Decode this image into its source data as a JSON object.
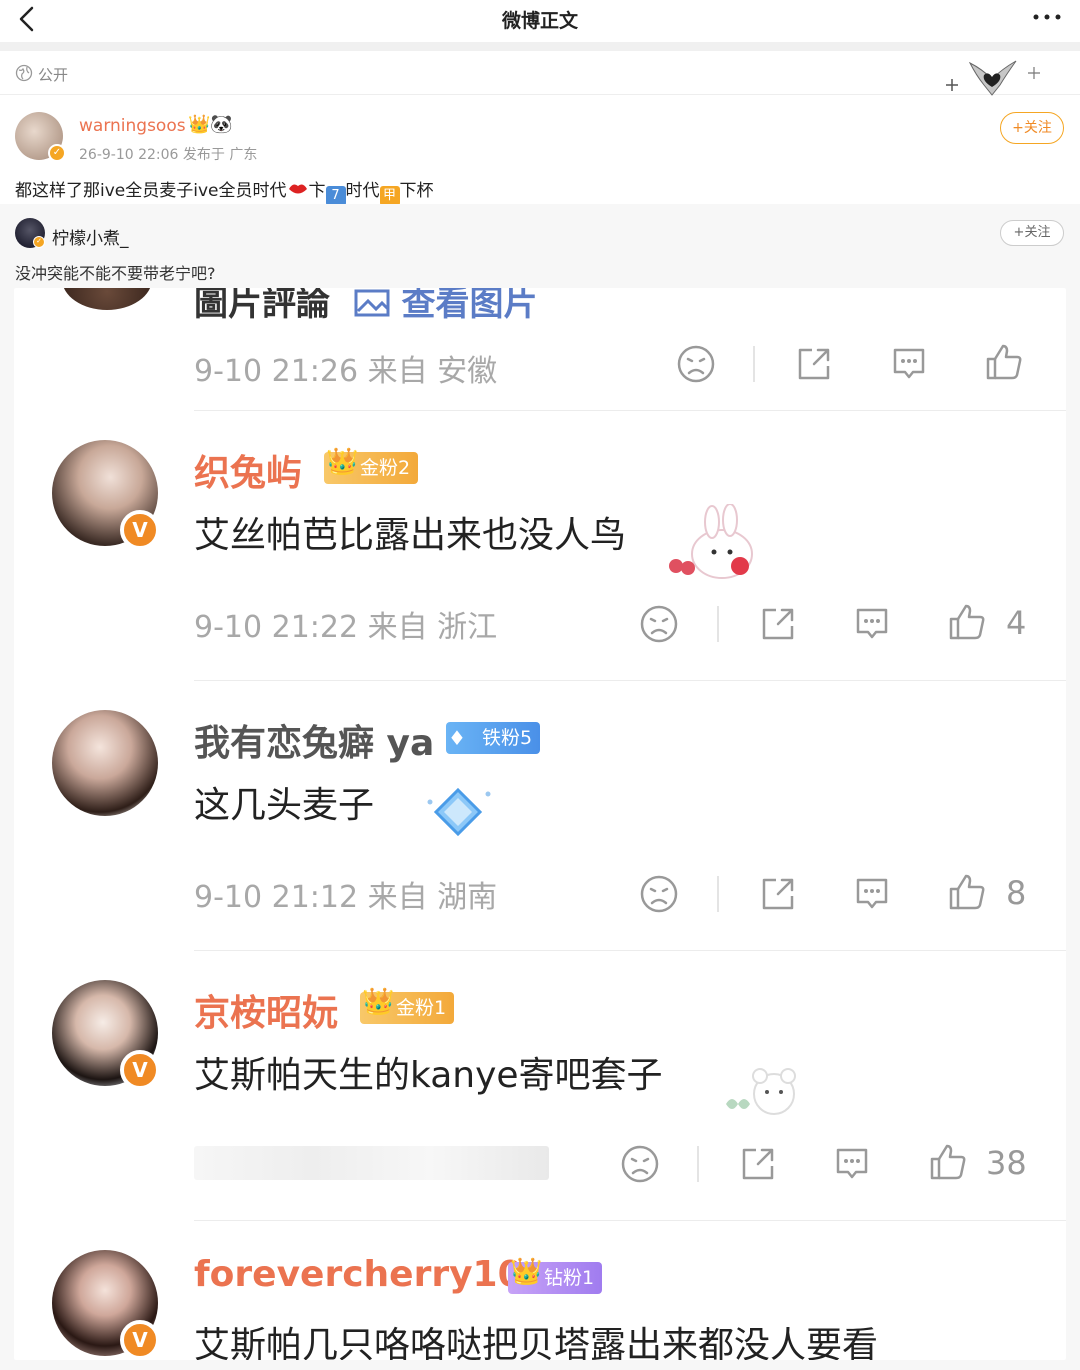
{
  "header": {
    "title": "微博正文"
  },
  "visibility": {
    "label": "公开"
  },
  "post": {
    "author": "warningsoos",
    "author_emoji": "👑🐼",
    "meta": "26-9-10 22:06  发布于 广东",
    "follow_label": "+关注",
    "text_a": "都这样了那ive全员麦子ive全员时代",
    "text_b": "卞",
    "emoji_7": "7",
    "text_c": "时代",
    "emoji_jia": "甲",
    "text_d": "下杯"
  },
  "comment": {
    "author": "柠檬小煮_",
    "follow_label": "+关注",
    "text": "没冲突能不能不要带老宁吧?"
  },
  "screenshot": {
    "cut_off": {
      "title": "圖片評論",
      "link": "查看图片",
      "meta": "9-10 21:26 来自 安徽"
    },
    "comments": [
      {
        "name": "织兔屿",
        "badge": "金粉2",
        "body": "艾丝帕芭比露出来也没人鸟",
        "meta": "9-10 21:22 来自 浙江",
        "likes": "4"
      },
      {
        "name": "我有恋兔癖 ya",
        "badge": "铁粉5",
        "body": "这几头麦子",
        "meta": "9-10 21:12 来自 湖南",
        "likes": "8"
      },
      {
        "name": "京桉昭妧",
        "badge": "金粉1",
        "body": "艾斯帕天生的kanye寄吧套子",
        "meta": "",
        "likes": "38"
      },
      {
        "name": "forevercherry10",
        "badge": "钻粉1",
        "body": "艾斯帕几只咯咯哒把贝塔露出来都没人要看",
        "meta": "",
        "likes": ""
      }
    ]
  },
  "colors": {
    "accent_orange": "#eb7350",
    "gold_badge": "#f5b63a",
    "iron_badge": "#5aa4f0",
    "diamond_badge": "#b08cf0"
  }
}
